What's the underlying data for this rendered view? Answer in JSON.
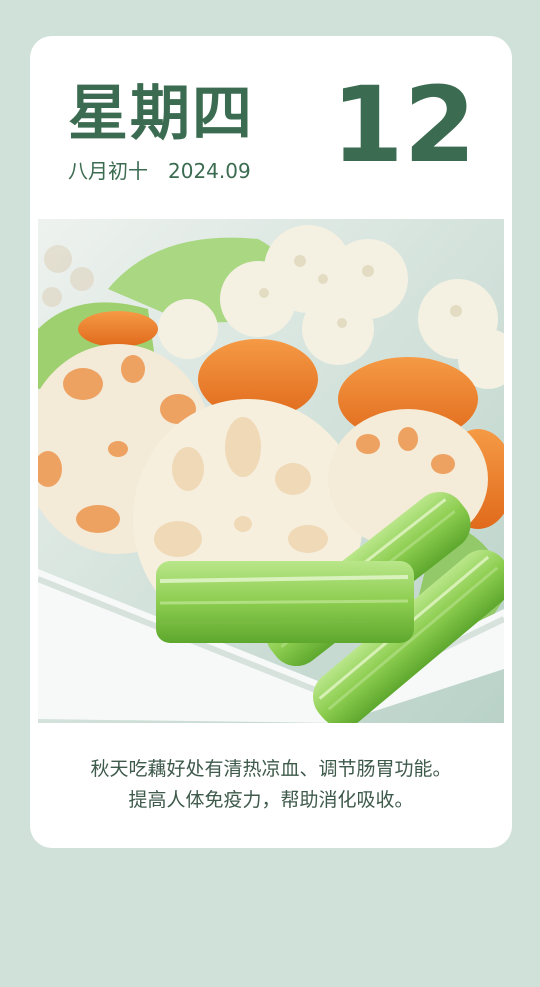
{
  "calendar": {
    "weekday": "星期四",
    "lunar_date": "八月初十",
    "year_month": "2024.09",
    "day": "12"
  },
  "photo": {
    "subject": "lotus-root-celery-carrot-cauliflower-dish"
  },
  "caption": {
    "line1": "秋天吃藕好处有清热凉血、调节肠胃功能。",
    "line2": "提高人体免疫力，帮助消化吸收。"
  },
  "colors": {
    "background": "#cfe1d8",
    "card": "#ffffff",
    "accent": "#3b6b50",
    "caption_text": "#3e5a4b"
  }
}
